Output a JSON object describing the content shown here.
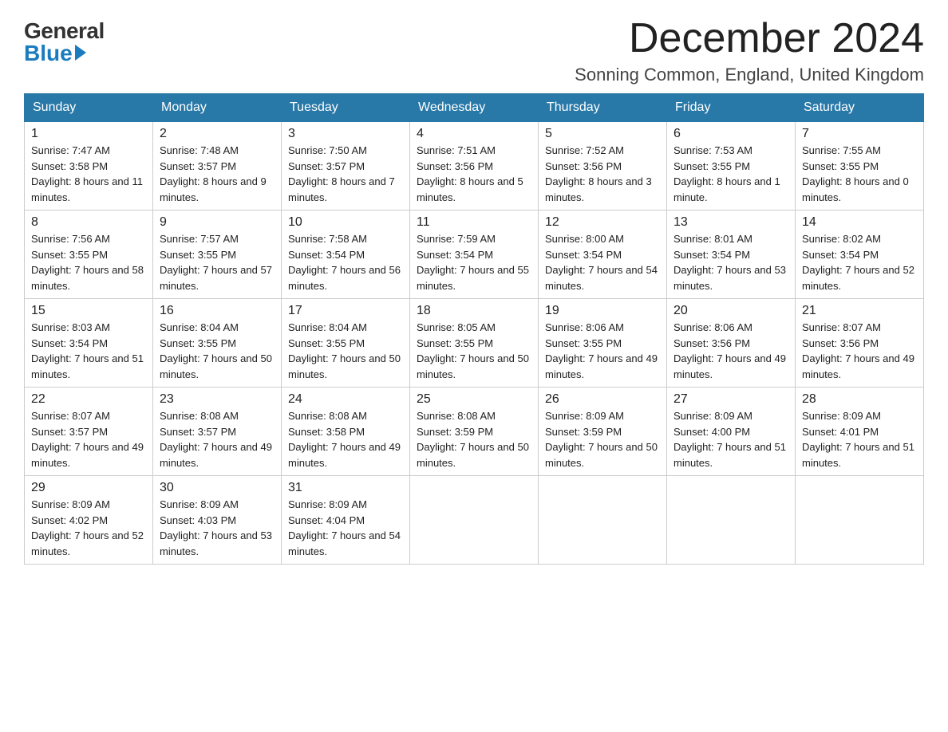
{
  "header": {
    "logo_general": "General",
    "logo_blue": "Blue",
    "month_title": "December 2024",
    "location": "Sonning Common, England, United Kingdom"
  },
  "days_of_week": [
    "Sunday",
    "Monday",
    "Tuesday",
    "Wednesday",
    "Thursday",
    "Friday",
    "Saturday"
  ],
  "weeks": [
    [
      {
        "num": "1",
        "sunrise": "7:47 AM",
        "sunset": "3:58 PM",
        "daylight": "8 hours and 11 minutes."
      },
      {
        "num": "2",
        "sunrise": "7:48 AM",
        "sunset": "3:57 PM",
        "daylight": "8 hours and 9 minutes."
      },
      {
        "num": "3",
        "sunrise": "7:50 AM",
        "sunset": "3:57 PM",
        "daylight": "8 hours and 7 minutes."
      },
      {
        "num": "4",
        "sunrise": "7:51 AM",
        "sunset": "3:56 PM",
        "daylight": "8 hours and 5 minutes."
      },
      {
        "num": "5",
        "sunrise": "7:52 AM",
        "sunset": "3:56 PM",
        "daylight": "8 hours and 3 minutes."
      },
      {
        "num": "6",
        "sunrise": "7:53 AM",
        "sunset": "3:55 PM",
        "daylight": "8 hours and 1 minute."
      },
      {
        "num": "7",
        "sunrise": "7:55 AM",
        "sunset": "3:55 PM",
        "daylight": "8 hours and 0 minutes."
      }
    ],
    [
      {
        "num": "8",
        "sunrise": "7:56 AM",
        "sunset": "3:55 PM",
        "daylight": "7 hours and 58 minutes."
      },
      {
        "num": "9",
        "sunrise": "7:57 AM",
        "sunset": "3:55 PM",
        "daylight": "7 hours and 57 minutes."
      },
      {
        "num": "10",
        "sunrise": "7:58 AM",
        "sunset": "3:54 PM",
        "daylight": "7 hours and 56 minutes."
      },
      {
        "num": "11",
        "sunrise": "7:59 AM",
        "sunset": "3:54 PM",
        "daylight": "7 hours and 55 minutes."
      },
      {
        "num": "12",
        "sunrise": "8:00 AM",
        "sunset": "3:54 PM",
        "daylight": "7 hours and 54 minutes."
      },
      {
        "num": "13",
        "sunrise": "8:01 AM",
        "sunset": "3:54 PM",
        "daylight": "7 hours and 53 minutes."
      },
      {
        "num": "14",
        "sunrise": "8:02 AM",
        "sunset": "3:54 PM",
        "daylight": "7 hours and 52 minutes."
      }
    ],
    [
      {
        "num": "15",
        "sunrise": "8:03 AM",
        "sunset": "3:54 PM",
        "daylight": "7 hours and 51 minutes."
      },
      {
        "num": "16",
        "sunrise": "8:04 AM",
        "sunset": "3:55 PM",
        "daylight": "7 hours and 50 minutes."
      },
      {
        "num": "17",
        "sunrise": "8:04 AM",
        "sunset": "3:55 PM",
        "daylight": "7 hours and 50 minutes."
      },
      {
        "num": "18",
        "sunrise": "8:05 AM",
        "sunset": "3:55 PM",
        "daylight": "7 hours and 50 minutes."
      },
      {
        "num": "19",
        "sunrise": "8:06 AM",
        "sunset": "3:55 PM",
        "daylight": "7 hours and 49 minutes."
      },
      {
        "num": "20",
        "sunrise": "8:06 AM",
        "sunset": "3:56 PM",
        "daylight": "7 hours and 49 minutes."
      },
      {
        "num": "21",
        "sunrise": "8:07 AM",
        "sunset": "3:56 PM",
        "daylight": "7 hours and 49 minutes."
      }
    ],
    [
      {
        "num": "22",
        "sunrise": "8:07 AM",
        "sunset": "3:57 PM",
        "daylight": "7 hours and 49 minutes."
      },
      {
        "num": "23",
        "sunrise": "8:08 AM",
        "sunset": "3:57 PM",
        "daylight": "7 hours and 49 minutes."
      },
      {
        "num": "24",
        "sunrise": "8:08 AM",
        "sunset": "3:58 PM",
        "daylight": "7 hours and 49 minutes."
      },
      {
        "num": "25",
        "sunrise": "8:08 AM",
        "sunset": "3:59 PM",
        "daylight": "7 hours and 50 minutes."
      },
      {
        "num": "26",
        "sunrise": "8:09 AM",
        "sunset": "3:59 PM",
        "daylight": "7 hours and 50 minutes."
      },
      {
        "num": "27",
        "sunrise": "8:09 AM",
        "sunset": "4:00 PM",
        "daylight": "7 hours and 51 minutes."
      },
      {
        "num": "28",
        "sunrise": "8:09 AM",
        "sunset": "4:01 PM",
        "daylight": "7 hours and 51 minutes."
      }
    ],
    [
      {
        "num": "29",
        "sunrise": "8:09 AM",
        "sunset": "4:02 PM",
        "daylight": "7 hours and 52 minutes."
      },
      {
        "num": "30",
        "sunrise": "8:09 AM",
        "sunset": "4:03 PM",
        "daylight": "7 hours and 53 minutes."
      },
      {
        "num": "31",
        "sunrise": "8:09 AM",
        "sunset": "4:04 PM",
        "daylight": "7 hours and 54 minutes."
      },
      null,
      null,
      null,
      null
    ]
  ]
}
